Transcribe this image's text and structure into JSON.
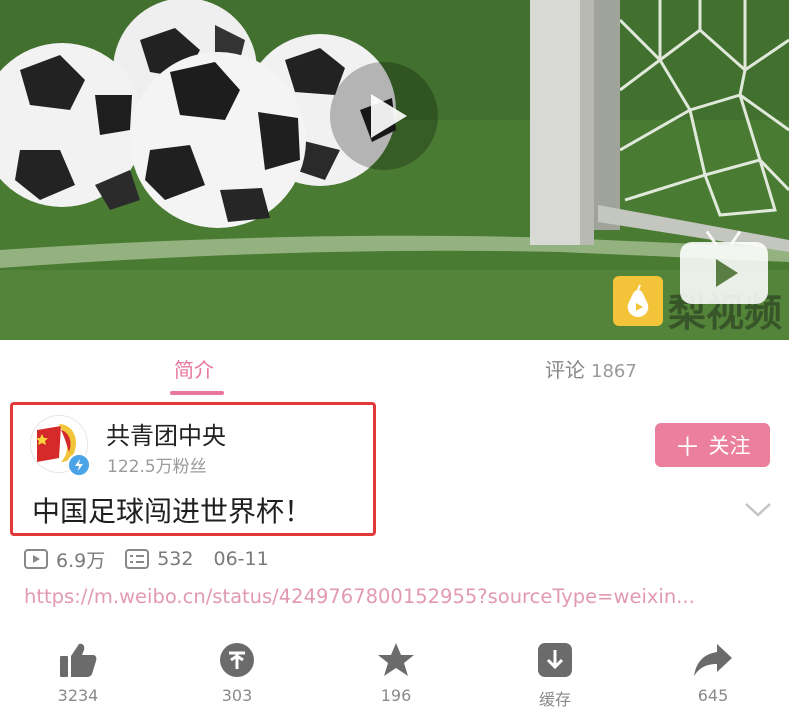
{
  "video": {
    "watermark_text": "梨视频",
    "play_icon": "play-icon",
    "colors": {
      "grass": "#4b7d34",
      "ball_white": "#f2f2f2",
      "ball_black": "#1e1e1e"
    }
  },
  "tabs": [
    {
      "label": "简介",
      "active": true
    },
    {
      "label": "评论",
      "count": "1867",
      "active": false
    }
  ],
  "author": {
    "name": "共青团中央",
    "fans": "122.5万粉丝",
    "follow_label": "关注",
    "follow_icon": "plus-icon",
    "verified_icon": "verified-badge-icon"
  },
  "post": {
    "text": "中国足球闯进世界杯！"
  },
  "stats": {
    "plays": "6.9万",
    "danmaku": "532",
    "date": "06-11"
  },
  "link": "https://m.weibo.cn/status/4249767800152955?sourceType=weixin...",
  "actions": [
    {
      "icon": "thumbs-up-icon",
      "label": "3234"
    },
    {
      "icon": "coin-icon",
      "label": "303"
    },
    {
      "icon": "star-icon",
      "label": "196"
    },
    {
      "icon": "download-icon",
      "label": "缓存"
    },
    {
      "icon": "share-icon",
      "label": "645"
    }
  ],
  "colors": {
    "accent": "#e8779a",
    "follow_bg": "#eb7f9c",
    "highlight": "#e23838",
    "link": "#e29ab0"
  }
}
